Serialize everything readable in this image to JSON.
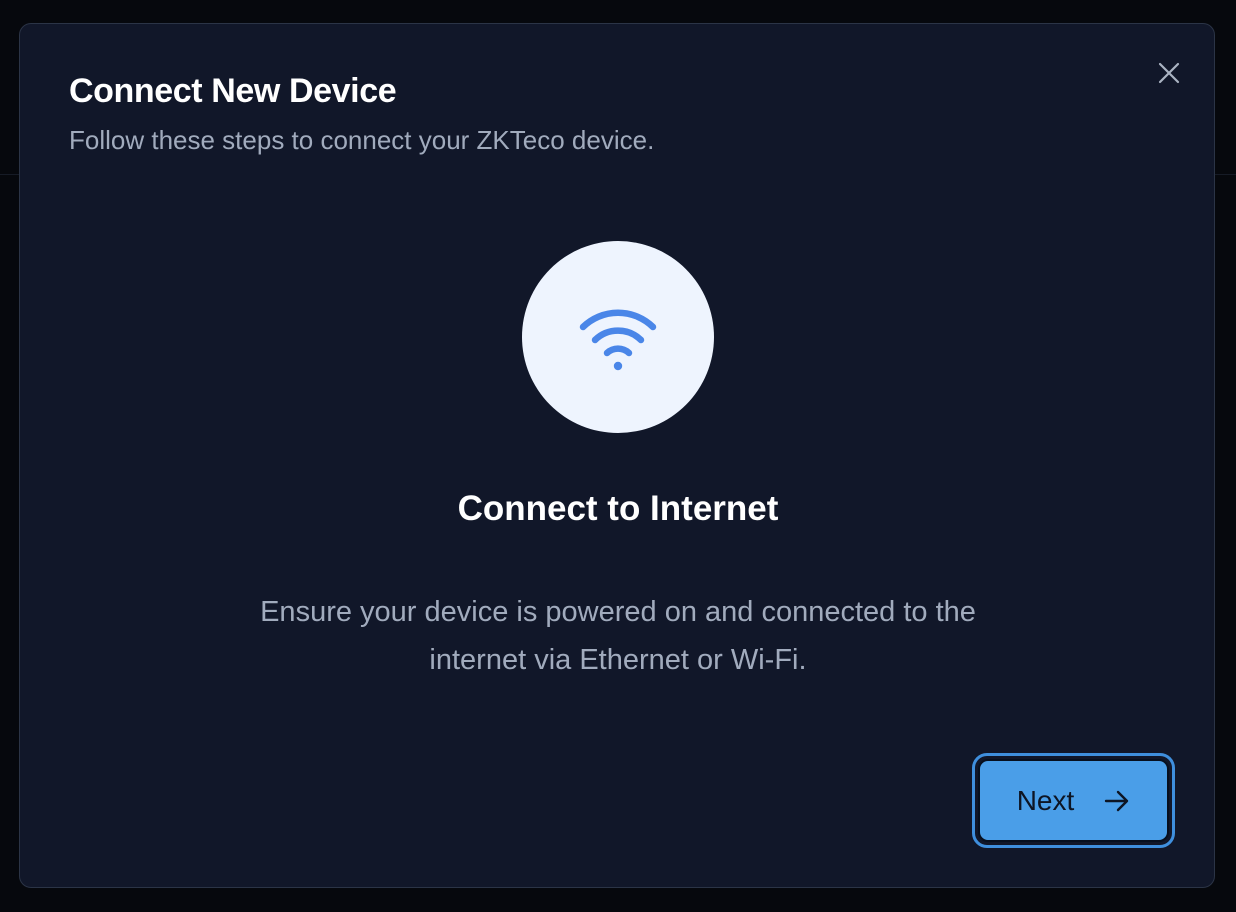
{
  "dialog": {
    "title": "Connect New Device",
    "subtitle": "Follow these steps to connect your ZKTeco device.",
    "close_icon": "close-icon"
  },
  "step": {
    "icon": "wifi-icon",
    "title": "Connect to Internet",
    "description": "Ensure your device is powered on and connected to the internet via Ethernet or Wi-Fi."
  },
  "actions": {
    "next_label": "Next",
    "next_icon": "arrow-right-icon"
  },
  "colors": {
    "background": "#06080d",
    "dialog_bg": "#111729",
    "accent": "#4a9ee8",
    "icon_blue": "#4a86e8",
    "icon_circle": "#eef4fe",
    "muted_text": "#a1abbd"
  }
}
